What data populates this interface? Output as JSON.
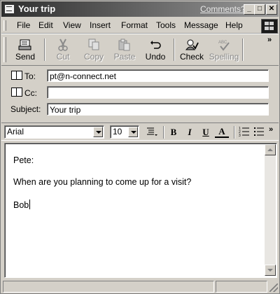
{
  "window": {
    "title": "Your trip",
    "comments_link": "Comments?",
    "minimize_glyph": "_",
    "maximize_glyph": "□",
    "close_glyph": "✕"
  },
  "menu": {
    "items": [
      "File",
      "Edit",
      "View",
      "Insert",
      "Format",
      "Tools",
      "Message",
      "Help"
    ]
  },
  "toolbar": {
    "send": "Send",
    "cut": "Cut",
    "copy": "Copy",
    "paste": "Paste",
    "undo": "Undo",
    "check": "Check",
    "spelling": "Spelling",
    "more": "»"
  },
  "header": {
    "to_label": "To:",
    "cc_label": "Cc:",
    "subject_label": "Subject:",
    "to_value": "pt@n-connect.net",
    "cc_value": "",
    "subject_value": "Your trip"
  },
  "format": {
    "font_name": "Arial",
    "font_size": "10",
    "bold": "B",
    "italic": "I",
    "underline": "U",
    "font_color": "A",
    "more": "»"
  },
  "message": {
    "greeting": "Pete:",
    "line1": "When are you planning to come up for a visit?",
    "signature": "Bob"
  },
  "colors": {
    "chrome": "#d4d0c8",
    "title_dark": "#2e2e2e",
    "title_light": "#9a9a9a"
  }
}
